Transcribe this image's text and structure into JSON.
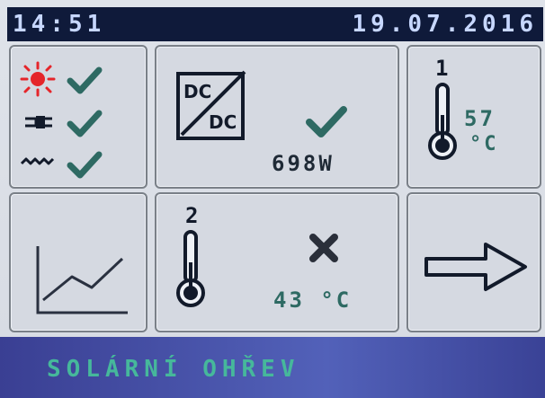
{
  "status": {
    "time": "14:51",
    "date": "19.07.2016"
  },
  "indicators": {
    "row1": {
      "icon": "sun-icon",
      "state": "ok"
    },
    "row2": {
      "icon": "plug-icon",
      "state": "ok"
    },
    "row3": {
      "icon": "heater-icon",
      "state": "ok"
    }
  },
  "dcdc": {
    "top": "DC",
    "bottom": "DC",
    "power": "698W",
    "state": "ok"
  },
  "temp1": {
    "index": "1",
    "value": "57",
    "unit": "°C"
  },
  "temp2": {
    "index": "2",
    "value": "43 °C",
    "state": "error"
  },
  "footer": {
    "title": "SOLÁRNÍ OHŘEV"
  },
  "colors": {
    "accent": "#46b89b",
    "check": "#2e6a63",
    "error": "#2a2f3a",
    "sun": "#e5252a"
  }
}
